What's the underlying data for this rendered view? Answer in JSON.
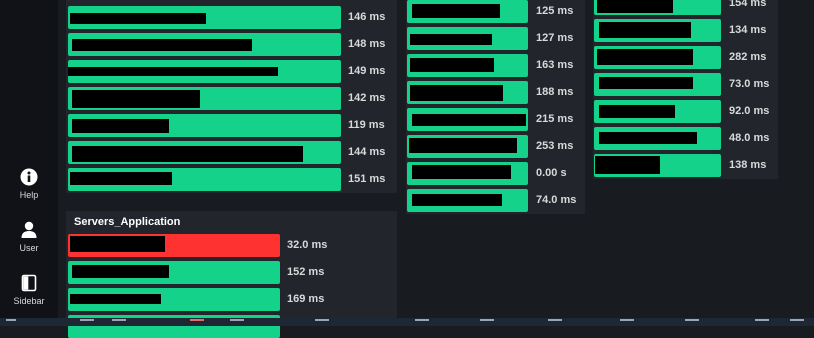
{
  "sidebar": {
    "items": [
      {
        "label": "Help",
        "icon": "info-icon"
      },
      {
        "label": "User",
        "icon": "user-icon"
      },
      {
        "label": "Sidebar",
        "icon": "sidebar-toggle-icon"
      }
    ]
  },
  "panels": {
    "col1": {
      "title": "",
      "rows": [
        {
          "value": "146 ms",
          "status": "ok"
        },
        {
          "value": "148 ms",
          "status": "ok"
        },
        {
          "value": "149 ms",
          "status": "ok"
        },
        {
          "value": "142 ms",
          "status": "ok"
        },
        {
          "value": "119 ms",
          "status": "ok"
        },
        {
          "value": "144 ms",
          "status": "ok"
        },
        {
          "value": "151 ms",
          "status": "ok"
        }
      ]
    },
    "col2": {
      "title": "",
      "rows": [
        {
          "value": "125 ms",
          "status": "ok"
        },
        {
          "value": "127 ms",
          "status": "ok"
        },
        {
          "value": "163 ms",
          "status": "ok"
        },
        {
          "value": "188 ms",
          "status": "ok"
        },
        {
          "value": "215 ms",
          "status": "ok"
        },
        {
          "value": "253 ms",
          "status": "ok"
        },
        {
          "value": "0.00 s",
          "status": "ok"
        },
        {
          "value": "74.0 ms",
          "status": "ok"
        }
      ]
    },
    "col3": {
      "title": "",
      "rows": [
        {
          "value": "154 ms",
          "status": "ok"
        },
        {
          "value": "134 ms",
          "status": "ok"
        },
        {
          "value": "282 ms",
          "status": "ok"
        },
        {
          "value": "73.0 ms",
          "status": "ok"
        },
        {
          "value": "92.0 ms",
          "status": "ok"
        },
        {
          "value": "48.0 ms",
          "status": "ok"
        },
        {
          "value": "138 ms",
          "status": "ok"
        }
      ]
    },
    "servers_application": {
      "title": "Servers_Application",
      "rows": [
        {
          "value": "32.0 ms",
          "status": "critical"
        },
        {
          "value": "152 ms",
          "status": "ok"
        },
        {
          "value": "169 ms",
          "status": "ok"
        }
      ]
    }
  },
  "colors": {
    "ok": "#14d28a",
    "critical": "#ff3232",
    "background": "#181b1f",
    "panel": "#22252b",
    "redaction": "#000000"
  }
}
